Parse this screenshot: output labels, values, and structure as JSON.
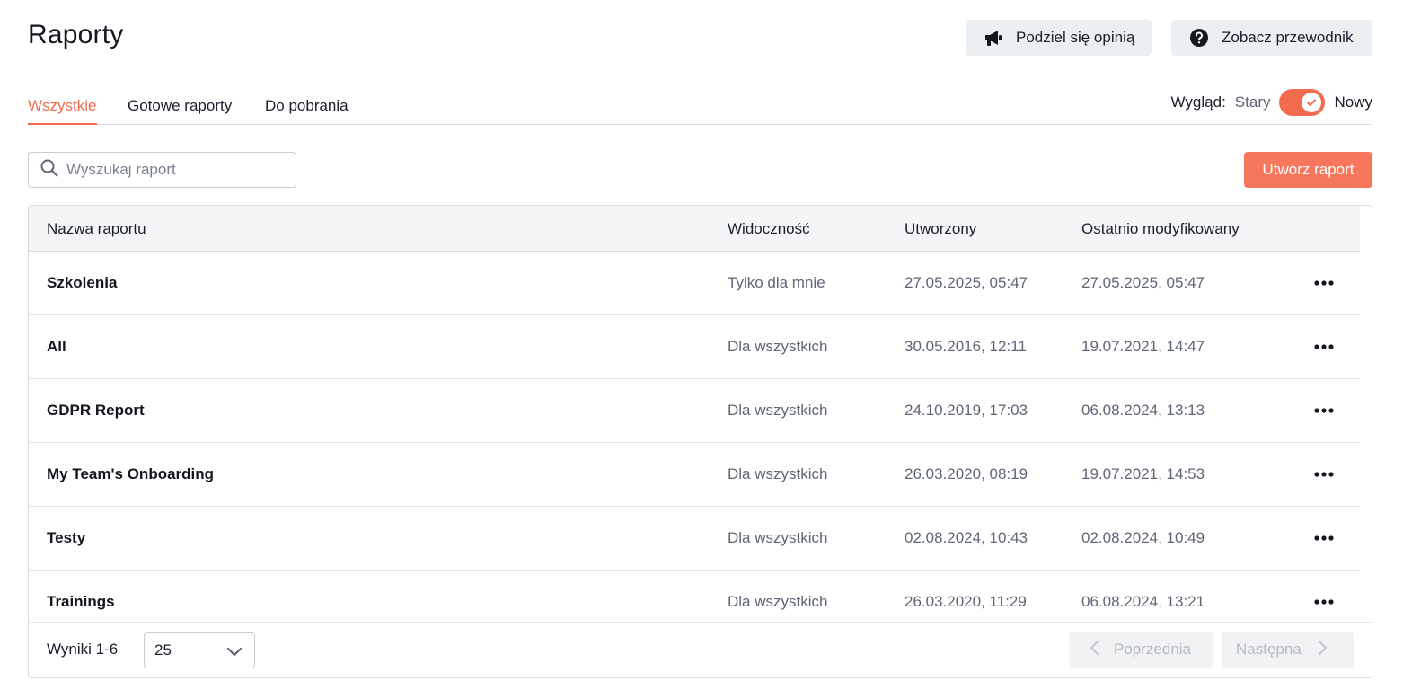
{
  "page": {
    "title": "Raporty"
  },
  "header_buttons": {
    "feedback": {
      "label": "Podziel się opinią",
      "icon": "megaphone-icon"
    },
    "guide": {
      "label": "Zobacz przewodnik",
      "icon": "question-circle-icon"
    }
  },
  "tabs": [
    {
      "label": "Wszystkie",
      "active": true
    },
    {
      "label": "Gotowe raporty",
      "active": false
    },
    {
      "label": "Do pobrania",
      "active": false
    }
  ],
  "view_switch": {
    "label": "Wygląd:",
    "old": "Stary",
    "new": "Nowy",
    "is_new": true
  },
  "search": {
    "placeholder": "Wyszukaj raport",
    "value": ""
  },
  "create_button": {
    "label": "Utwórz raport"
  },
  "table": {
    "headers": {
      "name": "Nazwa raportu",
      "visibility": "Widoczność",
      "created": "Utworzony",
      "modified": "Ostatnio modyfikowany"
    },
    "rows": [
      {
        "name": "Szkolenia",
        "visibility": "Tylko dla mnie",
        "created": "27.05.2025, 05:47",
        "modified": "27.05.2025, 05:47"
      },
      {
        "name": "All",
        "visibility": "Dla wszystkich",
        "created": "30.05.2016, 12:11",
        "modified": "19.07.2021, 14:47"
      },
      {
        "name": "GDPR Report",
        "visibility": "Dla wszystkich",
        "created": "24.10.2019, 17:03",
        "modified": "06.08.2024, 13:13"
      },
      {
        "name": "My Team's Onboarding",
        "visibility": "Dla wszystkich",
        "created": "26.03.2020, 08:19",
        "modified": "19.07.2021, 14:53"
      },
      {
        "name": "Testy",
        "visibility": "Dla wszystkich",
        "created": "02.08.2024, 10:43",
        "modified": "02.08.2024, 10:49"
      },
      {
        "name": "Trainings",
        "visibility": "Dla wszystkich",
        "created": "26.03.2020, 11:29",
        "modified": "06.08.2024, 13:21"
      }
    ]
  },
  "footer": {
    "results": "Wyniki 1-6",
    "page_size": "25",
    "prev": "Poprzednia",
    "next": "Następna"
  },
  "colors": {
    "accent": "#f26b4e",
    "create_button": "#f7775c",
    "header_bg": "#f4f5f7"
  }
}
